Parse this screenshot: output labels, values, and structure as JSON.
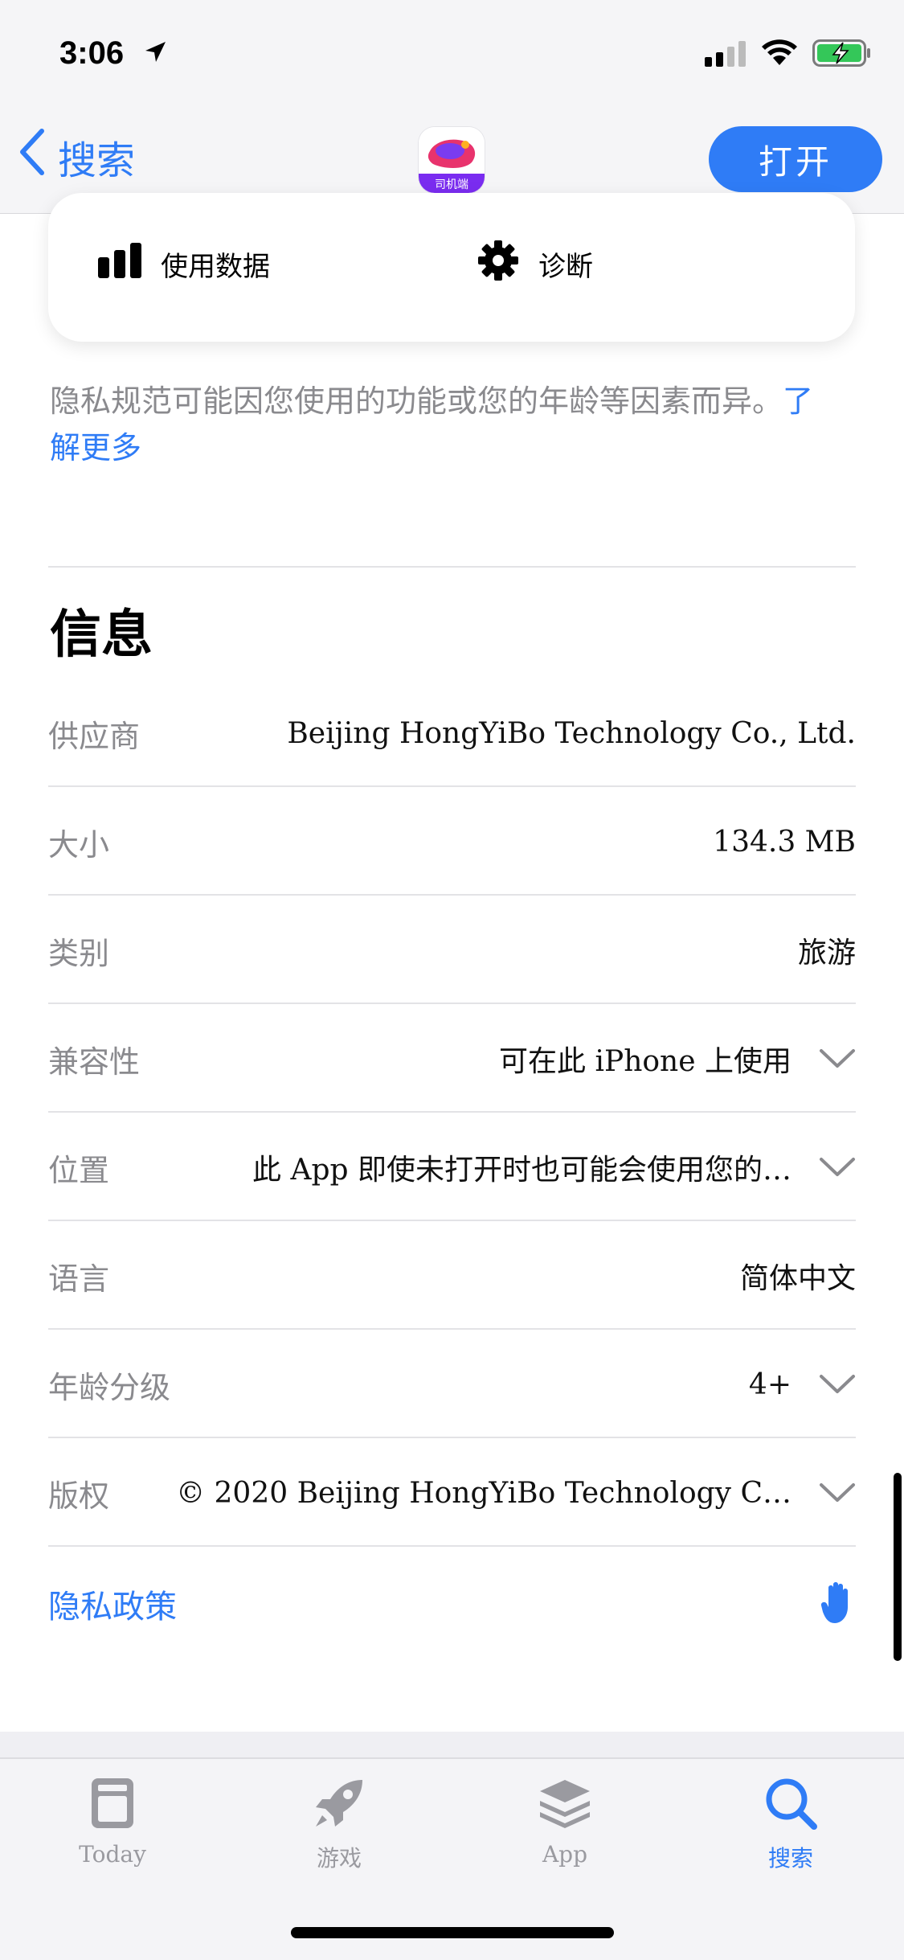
{
  "status_bar": {
    "time": "3:06",
    "signal_icon": "cellular-signal-icon",
    "wifi_icon": "wifi-icon",
    "battery_icon": "battery-charging-icon",
    "battery_color": "#34c759"
  },
  "nav": {
    "back_label": "搜索",
    "open_label": "打开",
    "app_icon_text": "司机端",
    "accent": "#2f7cf6"
  },
  "privacy_card": {
    "items": [
      {
        "label": "使用数据",
        "icon": "bar-chart-icon"
      },
      {
        "label": "诊断",
        "icon": "gear-icon"
      }
    ]
  },
  "privacy_note": {
    "text": "隐私规范可能因您使用的功能或您的年龄等因素而异。",
    "link": "了解更多"
  },
  "info": {
    "title": "信息",
    "rows": [
      {
        "label": "供应商",
        "value": "Beijing HongYiBo Technology Co., Ltd.",
        "expandable": false
      },
      {
        "label": "大小",
        "value": "134.3 MB",
        "expandable": false
      },
      {
        "label": "类别",
        "value": "旅游",
        "expandable": false
      },
      {
        "label": "兼容性",
        "value": "可在此 iPhone 上使用",
        "expandable": true
      },
      {
        "label": "位置",
        "value": "此 App 即使未打开时也可能会使用您的…",
        "expandable": true
      },
      {
        "label": "语言",
        "value": "简体中文",
        "expandable": false
      },
      {
        "label": "年龄分级",
        "value": "4+",
        "expandable": true
      },
      {
        "label": "版权",
        "value": "© 2020 Beijing HongYiBo Technology C…",
        "expandable": true
      }
    ],
    "policy_label": "隐私政策",
    "policy_icon": "hand-icon"
  },
  "tabbar": {
    "tabs": [
      {
        "label": "Today",
        "icon": "today-icon",
        "active": false
      },
      {
        "label": "游戏",
        "icon": "rocket-icon",
        "active": false
      },
      {
        "label": "App",
        "icon": "app-stack-icon",
        "active": false
      },
      {
        "label": "搜索",
        "icon": "search-icon",
        "active": true
      }
    ]
  }
}
